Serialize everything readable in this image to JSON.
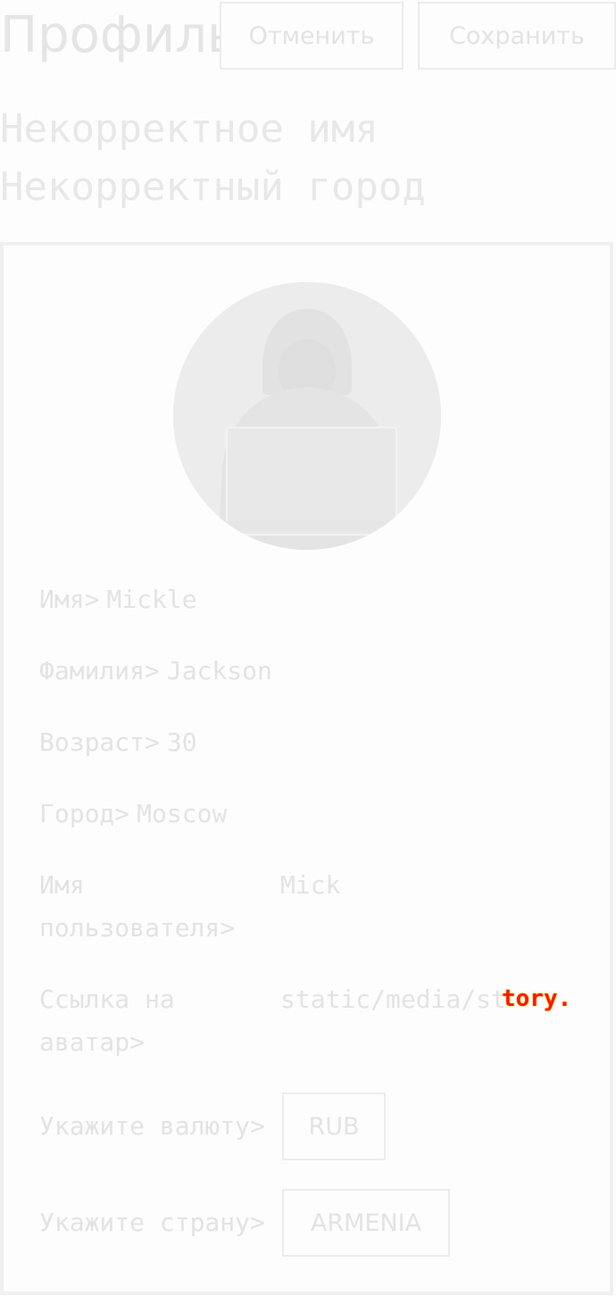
{
  "header": {
    "title": "Профиль",
    "cancel_label": "Отменить",
    "save_label": "Сохранить"
  },
  "errors": {
    "name": "Некорректное имя",
    "city": "Некорректный город"
  },
  "profile": {
    "first_name_label": "Имя>",
    "first_name_value": "Mickle",
    "last_name_label": "Фамилия>",
    "last_name_value": "Jackson",
    "age_label": "Возраст>",
    "age_value": "30",
    "city_label": "Город>",
    "city_value": "Moscow",
    "username_label": "Имя пользователя>",
    "username_value": "Mick",
    "avatar_url_label": "Ссылка на аватар>",
    "avatar_url_value": "static/media/st",
    "avatar_url_overlay": "tory.",
    "currency_label": "Укажите валюту>",
    "currency_value": "RUB",
    "country_label": "Укажите страну>",
    "country_value": "ARMENIA"
  },
  "colors": {
    "text": "#e3e3e3",
    "border": "#ececec",
    "background": "#fdfdfd",
    "overlay_text": "#ff1a00"
  }
}
